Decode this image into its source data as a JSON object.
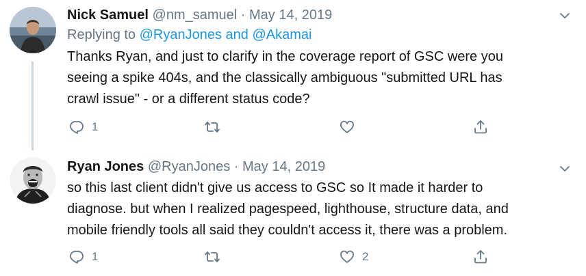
{
  "tweets": [
    {
      "name": "Nick Samuel",
      "handle": "@nm_samuel",
      "separator": "·",
      "date": "May 14, 2019",
      "replying_prefix": "Replying to ",
      "replying_mention_1": "@RyanJones",
      "replying_and": " and ",
      "replying_mention_2": "@Akamai",
      "text": "Thanks Ryan, and just to clarify in the coverage report of GSC were you\nseeing a spike 404s, and the classically ambiguous \"submitted URL has\ncrawl issue\" - or a different status code?",
      "reply_count": "1",
      "retweet_count": "",
      "like_count": "",
      "avatar_icon": "profile-photo-icon"
    },
    {
      "name": "Ryan Jones",
      "handle": "@RyanJones",
      "separator": "·",
      "date": "May 14, 2019",
      "text": "so this last client didn't give us access to GSC so It made it harder to\ndiagnose. but when I realized pagespeed, lighthouse, structure data, and\nmobile friendly tools all said they couldn't access it, there was a problem.",
      "reply_count": "1",
      "retweet_count": "",
      "like_count": "2",
      "avatar_icon": "profile-photo-icon"
    }
  ],
  "icons": {
    "reply": "reply-icon",
    "retweet": "retweet-icon",
    "like": "heart-icon",
    "share": "share-icon",
    "menu": "chevron-down-icon"
  },
  "colors": {
    "text": "#14171a",
    "secondary": "#657786",
    "link": "#1b95e0",
    "thread_line": "#ccd6dd"
  }
}
